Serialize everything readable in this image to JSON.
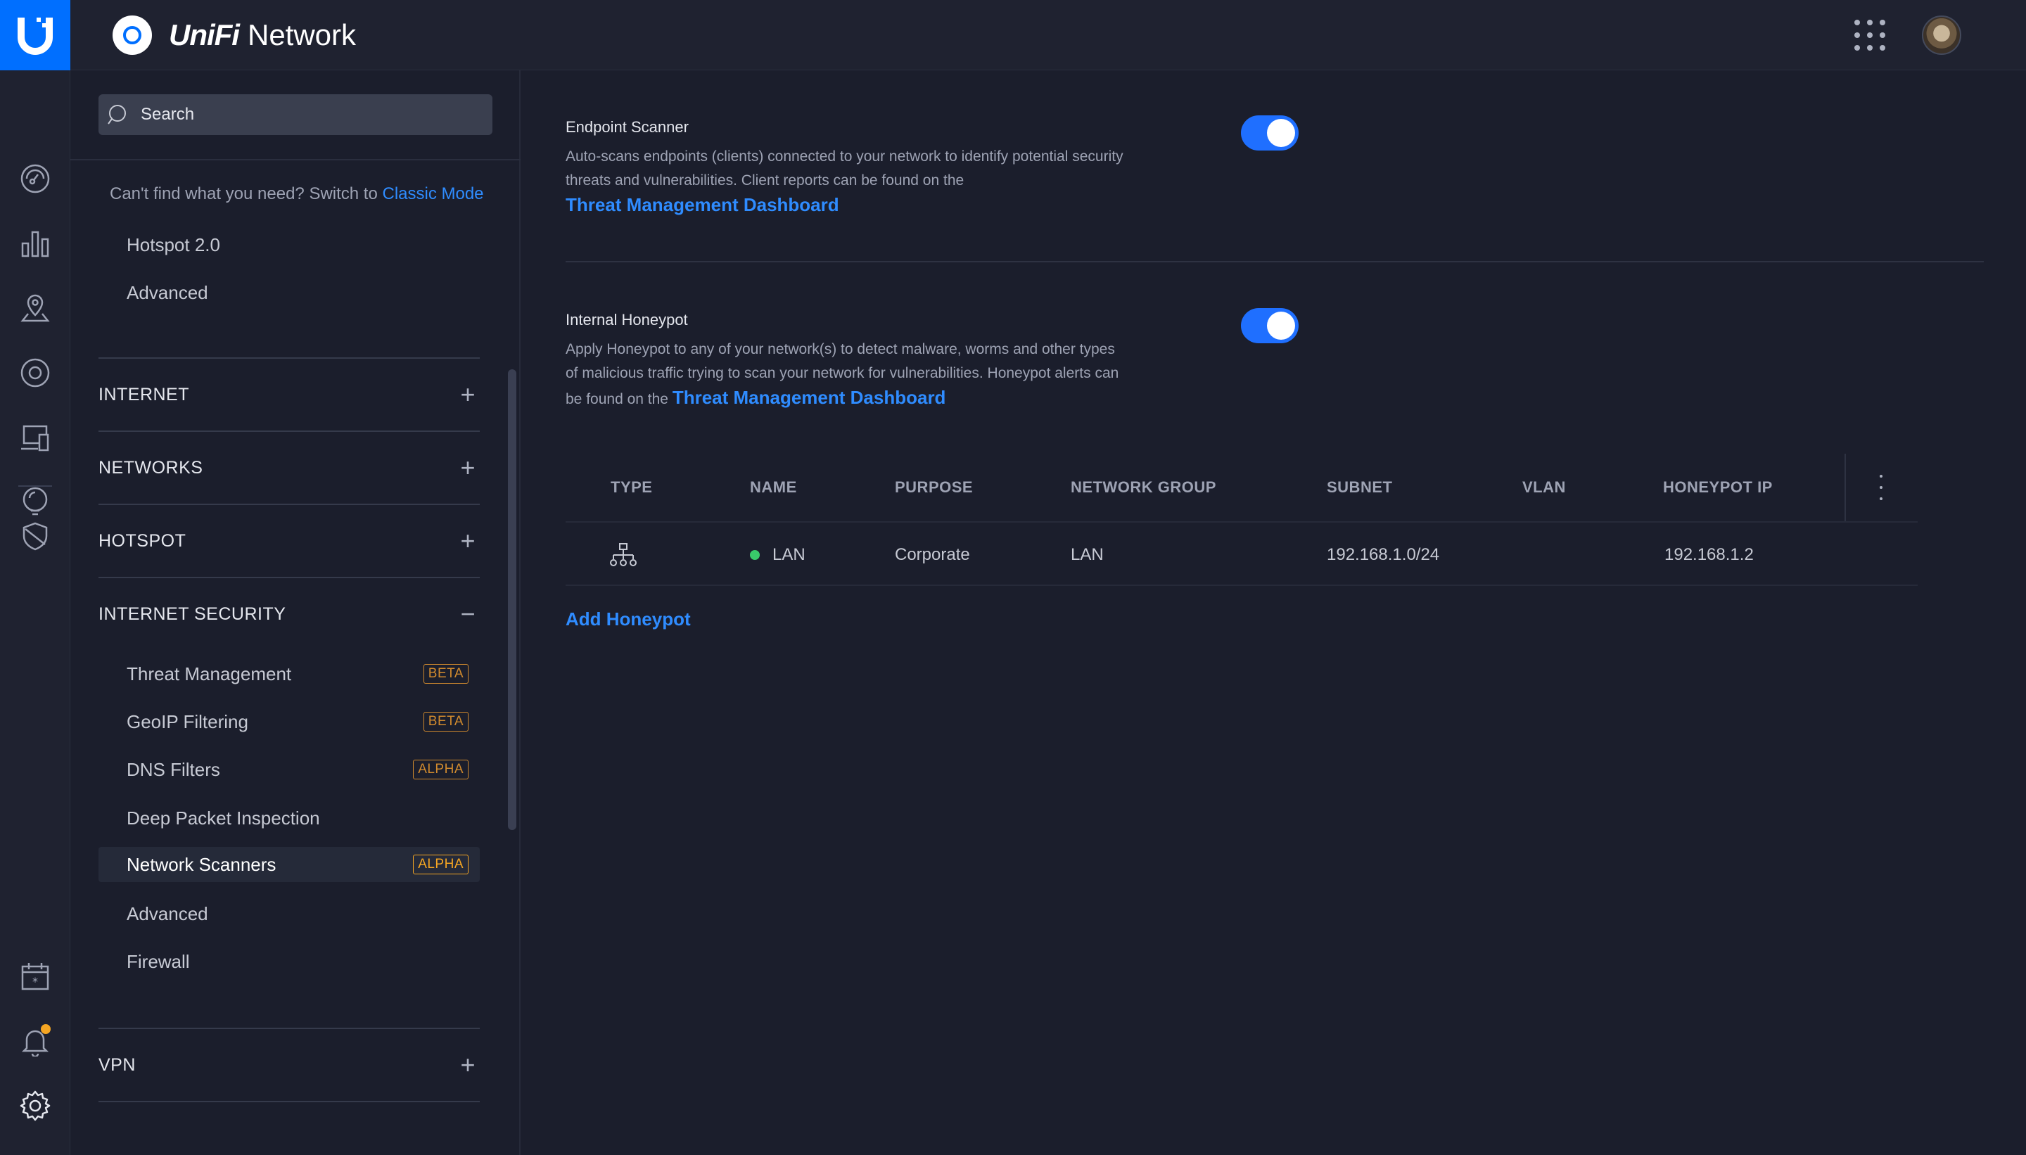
{
  "app": {
    "brand_letter": "U",
    "name_part1": "UniFi",
    "name_part2": "Network"
  },
  "sidebar": {
    "search_placeholder": "Search",
    "hint_text": "Can't find what you need? Switch to",
    "hint_link": "Classic Mode",
    "top_items": [
      {
        "label": "Hotspot 2.0"
      },
      {
        "label": "Advanced"
      }
    ],
    "sections": [
      {
        "label": "INTERNET",
        "glyph": "+"
      },
      {
        "label": "NETWORKS",
        "glyph": "+"
      },
      {
        "label": "HOTSPOT",
        "glyph": "+"
      },
      {
        "label": "INTERNET SECURITY",
        "glyph": "−"
      },
      {
        "label": "VPN",
        "glyph": "+"
      }
    ],
    "security_items": [
      {
        "label": "Threat Management",
        "badge": "BETA"
      },
      {
        "label": "GeoIP Filtering",
        "badge": "BETA"
      },
      {
        "label": "DNS Filters",
        "badge": "ALPHA"
      },
      {
        "label": "Deep Packet Inspection",
        "badge": ""
      },
      {
        "label": "Network Scanners",
        "badge": "ALPHA",
        "active": true
      },
      {
        "label": "Advanced",
        "badge": ""
      },
      {
        "label": "Firewall",
        "badge": ""
      }
    ]
  },
  "main": {
    "endpoint": {
      "title": "Endpoint Scanner",
      "desc": "Auto-scans endpoints (clients) connected to your network to identify potential security threats and vulnerabilities. Client reports can be found on the",
      "link": "Threat Management Dashboard",
      "enabled": true
    },
    "honeypot": {
      "title": "Internal Honeypot",
      "desc": "Apply Honeypot to any of your network(s) to detect malware, worms and other types of malicious traffic trying to scan your network for vulnerabilities. Honeypot alerts can be found on the",
      "link": "Threat Management Dashboard",
      "enabled": true
    },
    "table": {
      "columns": [
        "TYPE",
        "NAME",
        "PURPOSE",
        "NETWORK GROUP",
        "SUBNET",
        "VLAN",
        "HONEYPOT IP"
      ],
      "rows": [
        {
          "type_icon": "network-topology-icon",
          "name": "LAN",
          "status": "online",
          "purpose": "Corporate",
          "network_group": "LAN",
          "subnet": "192.168.1.0/24",
          "vlan": "",
          "honeypot_ip": "192.168.1.2"
        }
      ]
    },
    "add_label": "Add Honeypot"
  },
  "colors": {
    "accent": "#006fff",
    "link": "#2f8cff",
    "badge": "#d08a2e",
    "online": "#39c96a",
    "notification": "#f5a623"
  },
  "icons": [
    "dashboard-icon",
    "statistics-icon",
    "map-icon",
    "devices-icon",
    "clients-icon",
    "insights-icon",
    "security-shield-icon",
    "calendar-icon",
    "bell-icon",
    "settings-gear-icon",
    "apps-grid-icon",
    "avatar"
  ]
}
